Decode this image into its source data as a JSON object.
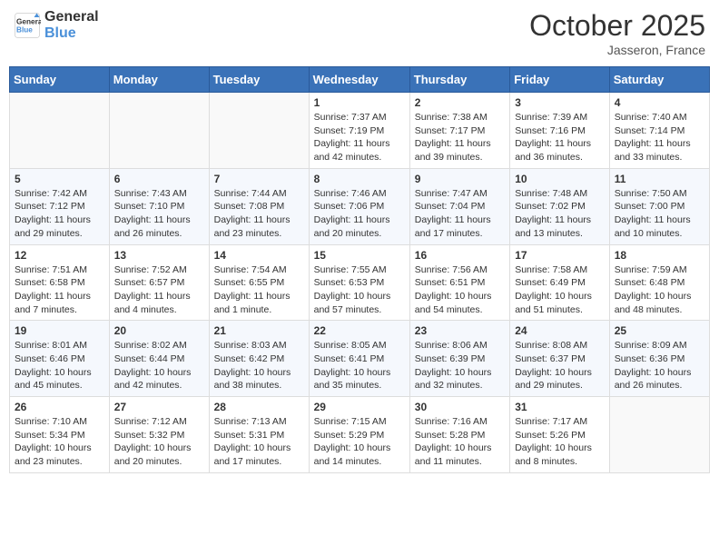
{
  "header": {
    "logo_general": "General",
    "logo_blue": "Blue",
    "month": "October 2025",
    "location": "Jasseron, France"
  },
  "days_of_week": [
    "Sunday",
    "Monday",
    "Tuesday",
    "Wednesday",
    "Thursday",
    "Friday",
    "Saturday"
  ],
  "weeks": [
    [
      {
        "day": "",
        "info": ""
      },
      {
        "day": "",
        "info": ""
      },
      {
        "day": "",
        "info": ""
      },
      {
        "day": "1",
        "info": "Sunrise: 7:37 AM\nSunset: 7:19 PM\nDaylight: 11 hours and 42 minutes."
      },
      {
        "day": "2",
        "info": "Sunrise: 7:38 AM\nSunset: 7:17 PM\nDaylight: 11 hours and 39 minutes."
      },
      {
        "day": "3",
        "info": "Sunrise: 7:39 AM\nSunset: 7:16 PM\nDaylight: 11 hours and 36 minutes."
      },
      {
        "day": "4",
        "info": "Sunrise: 7:40 AM\nSunset: 7:14 PM\nDaylight: 11 hours and 33 minutes."
      }
    ],
    [
      {
        "day": "5",
        "info": "Sunrise: 7:42 AM\nSunset: 7:12 PM\nDaylight: 11 hours and 29 minutes."
      },
      {
        "day": "6",
        "info": "Sunrise: 7:43 AM\nSunset: 7:10 PM\nDaylight: 11 hours and 26 minutes."
      },
      {
        "day": "7",
        "info": "Sunrise: 7:44 AM\nSunset: 7:08 PM\nDaylight: 11 hours and 23 minutes."
      },
      {
        "day": "8",
        "info": "Sunrise: 7:46 AM\nSunset: 7:06 PM\nDaylight: 11 hours and 20 minutes."
      },
      {
        "day": "9",
        "info": "Sunrise: 7:47 AM\nSunset: 7:04 PM\nDaylight: 11 hours and 17 minutes."
      },
      {
        "day": "10",
        "info": "Sunrise: 7:48 AM\nSunset: 7:02 PM\nDaylight: 11 hours and 13 minutes."
      },
      {
        "day": "11",
        "info": "Sunrise: 7:50 AM\nSunset: 7:00 PM\nDaylight: 11 hours and 10 minutes."
      }
    ],
    [
      {
        "day": "12",
        "info": "Sunrise: 7:51 AM\nSunset: 6:58 PM\nDaylight: 11 hours and 7 minutes."
      },
      {
        "day": "13",
        "info": "Sunrise: 7:52 AM\nSunset: 6:57 PM\nDaylight: 11 hours and 4 minutes."
      },
      {
        "day": "14",
        "info": "Sunrise: 7:54 AM\nSunset: 6:55 PM\nDaylight: 11 hours and 1 minute."
      },
      {
        "day": "15",
        "info": "Sunrise: 7:55 AM\nSunset: 6:53 PM\nDaylight: 10 hours and 57 minutes."
      },
      {
        "day": "16",
        "info": "Sunrise: 7:56 AM\nSunset: 6:51 PM\nDaylight: 10 hours and 54 minutes."
      },
      {
        "day": "17",
        "info": "Sunrise: 7:58 AM\nSunset: 6:49 PM\nDaylight: 10 hours and 51 minutes."
      },
      {
        "day": "18",
        "info": "Sunrise: 7:59 AM\nSunset: 6:48 PM\nDaylight: 10 hours and 48 minutes."
      }
    ],
    [
      {
        "day": "19",
        "info": "Sunrise: 8:01 AM\nSunset: 6:46 PM\nDaylight: 10 hours and 45 minutes."
      },
      {
        "day": "20",
        "info": "Sunrise: 8:02 AM\nSunset: 6:44 PM\nDaylight: 10 hours and 42 minutes."
      },
      {
        "day": "21",
        "info": "Sunrise: 8:03 AM\nSunset: 6:42 PM\nDaylight: 10 hours and 38 minutes."
      },
      {
        "day": "22",
        "info": "Sunrise: 8:05 AM\nSunset: 6:41 PM\nDaylight: 10 hours and 35 minutes."
      },
      {
        "day": "23",
        "info": "Sunrise: 8:06 AM\nSunset: 6:39 PM\nDaylight: 10 hours and 32 minutes."
      },
      {
        "day": "24",
        "info": "Sunrise: 8:08 AM\nSunset: 6:37 PM\nDaylight: 10 hours and 29 minutes."
      },
      {
        "day": "25",
        "info": "Sunrise: 8:09 AM\nSunset: 6:36 PM\nDaylight: 10 hours and 26 minutes."
      }
    ],
    [
      {
        "day": "26",
        "info": "Sunrise: 7:10 AM\nSunset: 5:34 PM\nDaylight: 10 hours and 23 minutes."
      },
      {
        "day": "27",
        "info": "Sunrise: 7:12 AM\nSunset: 5:32 PM\nDaylight: 10 hours and 20 minutes."
      },
      {
        "day": "28",
        "info": "Sunrise: 7:13 AM\nSunset: 5:31 PM\nDaylight: 10 hours and 17 minutes."
      },
      {
        "day": "29",
        "info": "Sunrise: 7:15 AM\nSunset: 5:29 PM\nDaylight: 10 hours and 14 minutes."
      },
      {
        "day": "30",
        "info": "Sunrise: 7:16 AM\nSunset: 5:28 PM\nDaylight: 10 hours and 11 minutes."
      },
      {
        "day": "31",
        "info": "Sunrise: 7:17 AM\nSunset: 5:26 PM\nDaylight: 10 hours and 8 minutes."
      },
      {
        "day": "",
        "info": ""
      }
    ]
  ]
}
